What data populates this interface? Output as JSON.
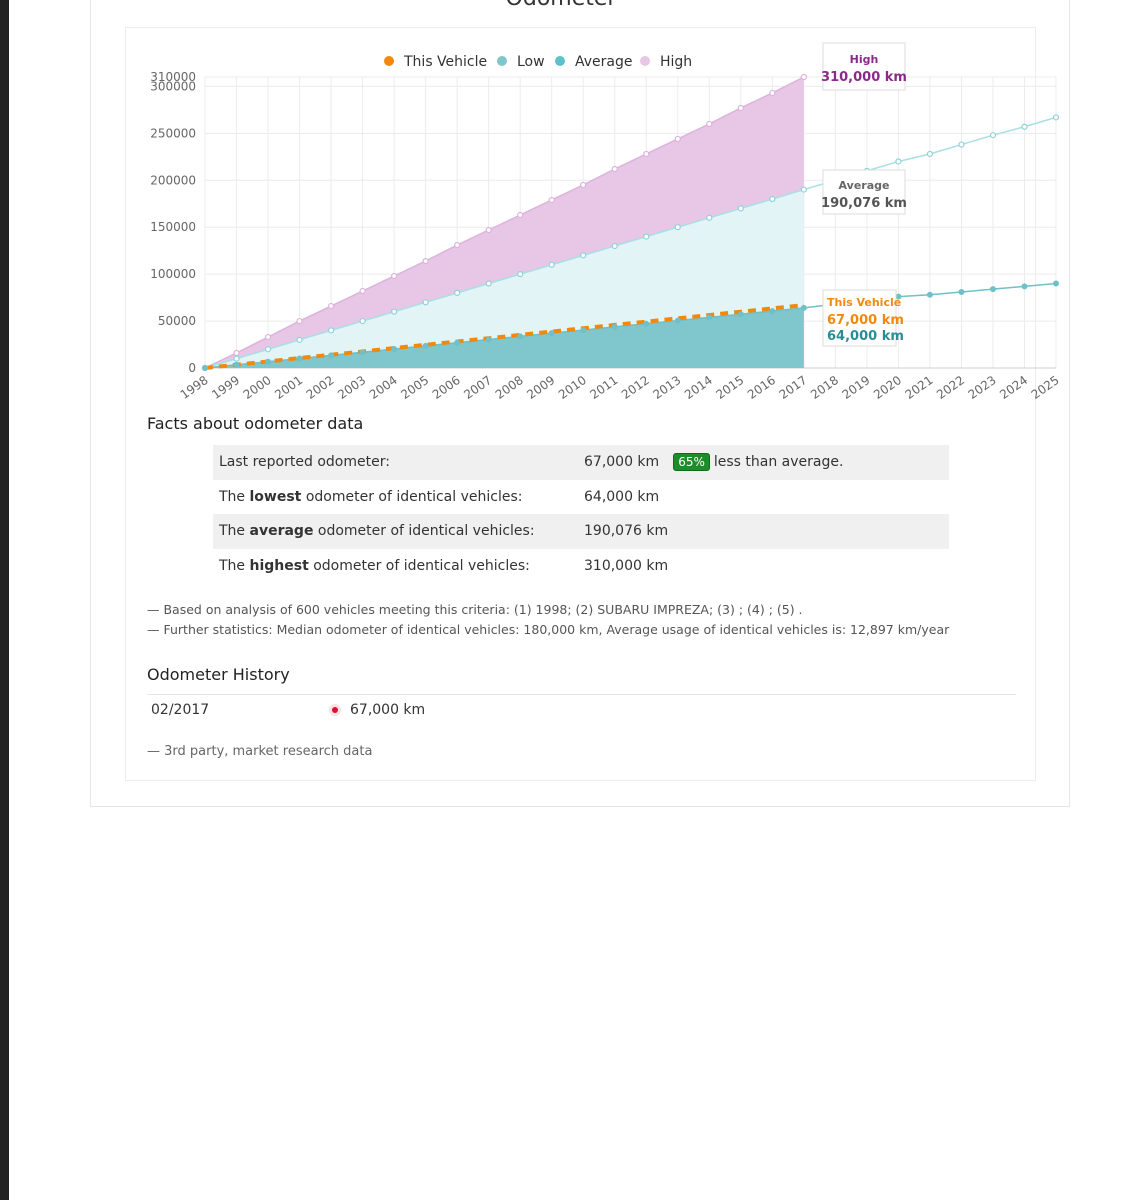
{
  "page_title": "Odometer",
  "legend": [
    {
      "label": "This Vehicle",
      "color": "#f0890e"
    },
    {
      "label": "Low",
      "color": "#7fc6cd"
    },
    {
      "label": "Average",
      "color": "#5cc1c9"
    },
    {
      "label": "High",
      "color": "#e7c6e6"
    }
  ],
  "callouts": {
    "high": {
      "title": "High",
      "value": "310,000 km"
    },
    "average": {
      "title": "Average",
      "value": "190,076 km"
    },
    "this_vehicle": {
      "title": "This Vehicle",
      "value": "67,000 km"
    },
    "low": {
      "value": "64,000 km"
    }
  },
  "chart_data": {
    "type": "area",
    "x": [
      "1998",
      "1999",
      "2000",
      "2001",
      "2002",
      "2003",
      "2004",
      "2005",
      "2006",
      "2007",
      "2008",
      "2009",
      "2010",
      "2011",
      "2012",
      "2013",
      "2014",
      "2015",
      "2016",
      "2017",
      "2018",
      "2019",
      "2020",
      "2021",
      "2022",
      "2023",
      "2024",
      "2025"
    ],
    "y_ticks": [
      "0",
      "50000",
      "100000",
      "150000",
      "200000",
      "250000",
      "300000",
      "310000"
    ],
    "ylim": [
      0,
      310000
    ],
    "series": [
      {
        "name": "High",
        "x_end": "2017",
        "values": [
          0,
          16000,
          33000,
          50000,
          66000,
          82000,
          98000,
          114000,
          131000,
          147000,
          163000,
          179000,
          195000,
          212000,
          228000,
          244000,
          260000,
          277000,
          293000,
          310000
        ]
      },
      {
        "name": "Average",
        "values": [
          0,
          10000,
          20000,
          30000,
          40000,
          50000,
          60000,
          70000,
          80000,
          90000,
          100000,
          110000,
          120000,
          130000,
          140000,
          150000,
          160000,
          170000,
          180000,
          190076,
          200000,
          210000,
          220000,
          228000,
          238000,
          248000,
          257000,
          267000
        ]
      },
      {
        "name": "Low",
        "values": [
          0,
          3400,
          6700,
          10100,
          13500,
          16800,
          20200,
          23600,
          26900,
          30300,
          33700,
          37100,
          40400,
          43800,
          47200,
          50500,
          53900,
          57300,
          60600,
          64000,
          68000,
          72000,
          76000,
          78000,
          81000,
          84000,
          87000,
          90000
        ]
      },
      {
        "name": "This Vehicle",
        "x_end": "2017",
        "values": [
          0,
          3500,
          7000,
          10600,
          14100,
          17600,
          21200,
          24700,
          28200,
          31700,
          35300,
          38800,
          42300,
          45900,
          49400,
          52900,
          56400,
          60000,
          63500,
          67000
        ]
      }
    ]
  },
  "facts": {
    "title": "Facts about odometer data",
    "rows": [
      {
        "label_pre": "Last reported odometer:",
        "label_bold": "",
        "label_post": "",
        "value": "67,000 km",
        "badge": "65%",
        "note": "less than average."
      },
      {
        "label_pre": "The ",
        "label_bold": "lowest",
        "label_post": " odometer of identical vehicles:",
        "value": "64,000 km"
      },
      {
        "label_pre": "The ",
        "label_bold": "average",
        "label_post": " odometer of identical vehicles:",
        "value": "190,076 km"
      },
      {
        "label_pre": "The ",
        "label_bold": "highest",
        "label_post": " odometer of identical vehicles:",
        "value": "310,000 km"
      }
    ]
  },
  "notes": [
    "— Based on analysis of 600 vehicles meeting this criteria: (1) 1998; (2) SUBARU IMPREZA; (3) ; (4) ; (5) .",
    "— Further statistics: Median odometer of identical vehicles: 180,000 km, Average usage of identical vehicles is: 12,897 km/year"
  ],
  "history": {
    "title": "Odometer History",
    "entries": [
      {
        "date": "02/2017",
        "value": "67,000 km"
      }
    ],
    "source": "— 3rd party, market research data"
  }
}
